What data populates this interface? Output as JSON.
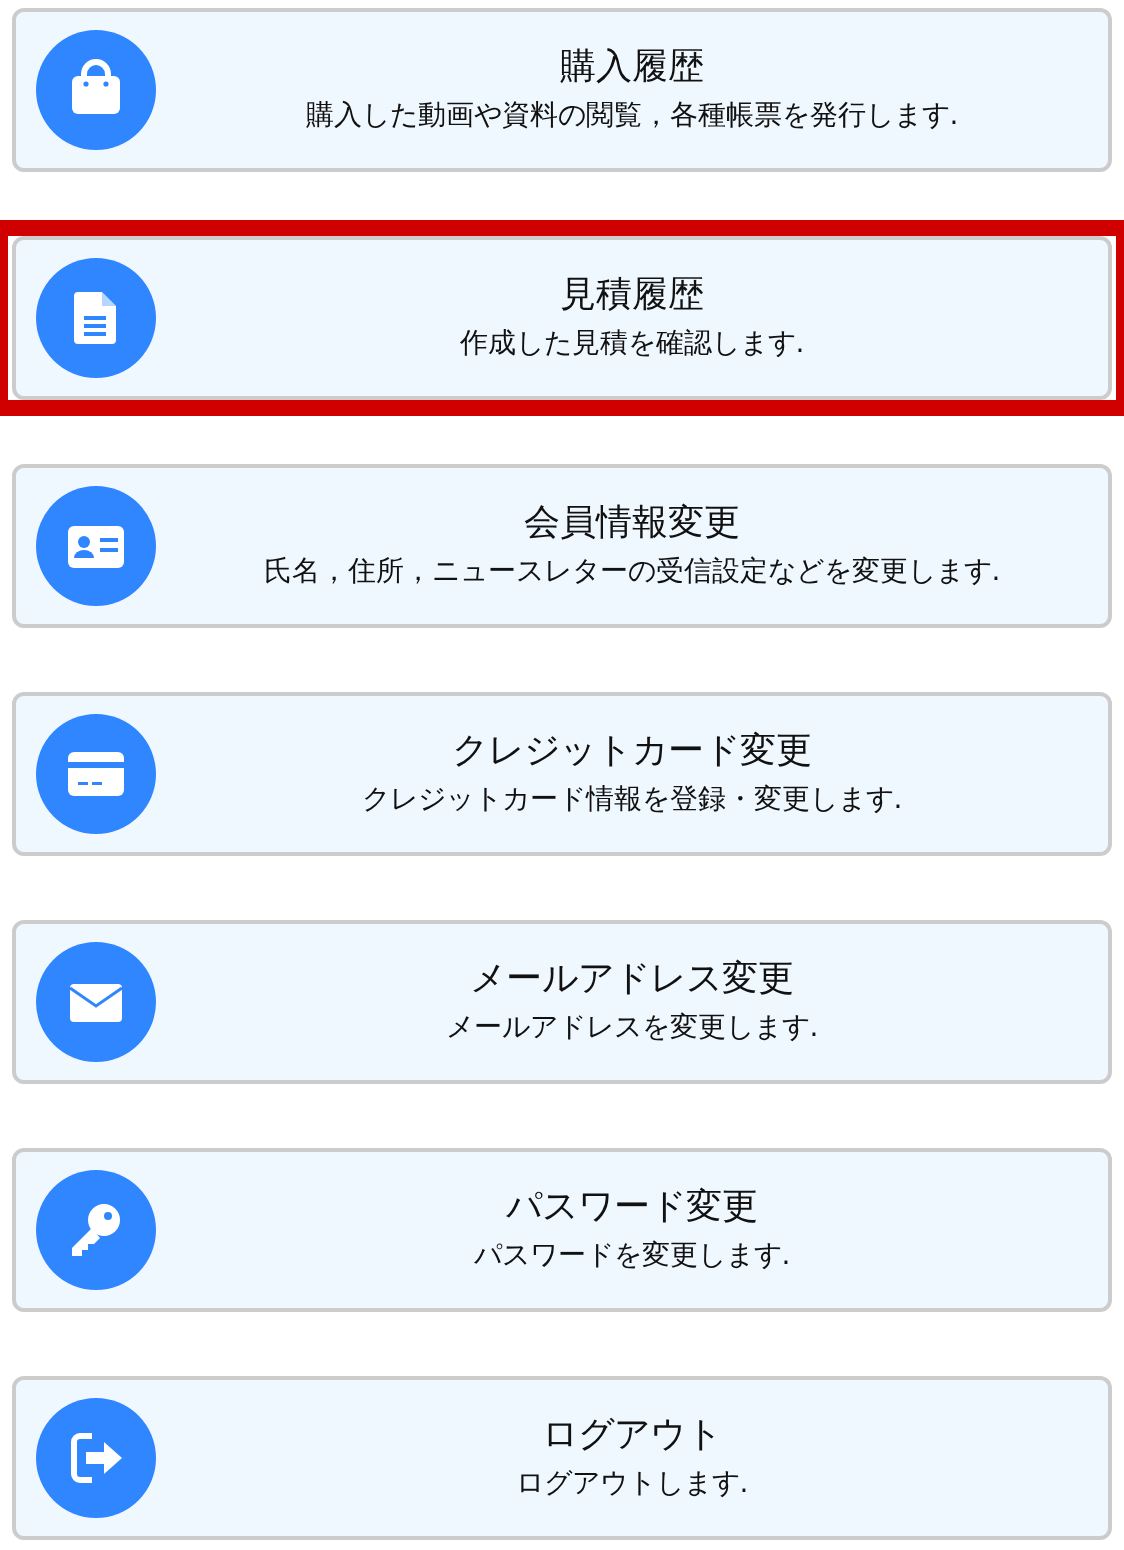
{
  "menu_items": [
    {
      "title": "購入履歴",
      "description": "購入した動画や資料の閲覧，各種帳票を発行します.",
      "highlighted": false
    },
    {
      "title": "見積履歴",
      "description": "作成した見積を確認します.",
      "highlighted": true
    },
    {
      "title": "会員情報変更",
      "description": "氏名，住所，ニュースレターの受信設定などを変更します.",
      "highlighted": false
    },
    {
      "title": "クレジットカード変更",
      "description": "クレジットカード情報を登録・変更します.",
      "highlighted": false
    },
    {
      "title": "メールアドレス変更",
      "description": "メールアドレスを変更します.",
      "highlighted": false
    },
    {
      "title": "パスワード変更",
      "description": "パスワードを変更します.",
      "highlighted": false
    },
    {
      "title": "ログアウト",
      "description": "ログアウトします.",
      "highlighted": false
    }
  ]
}
